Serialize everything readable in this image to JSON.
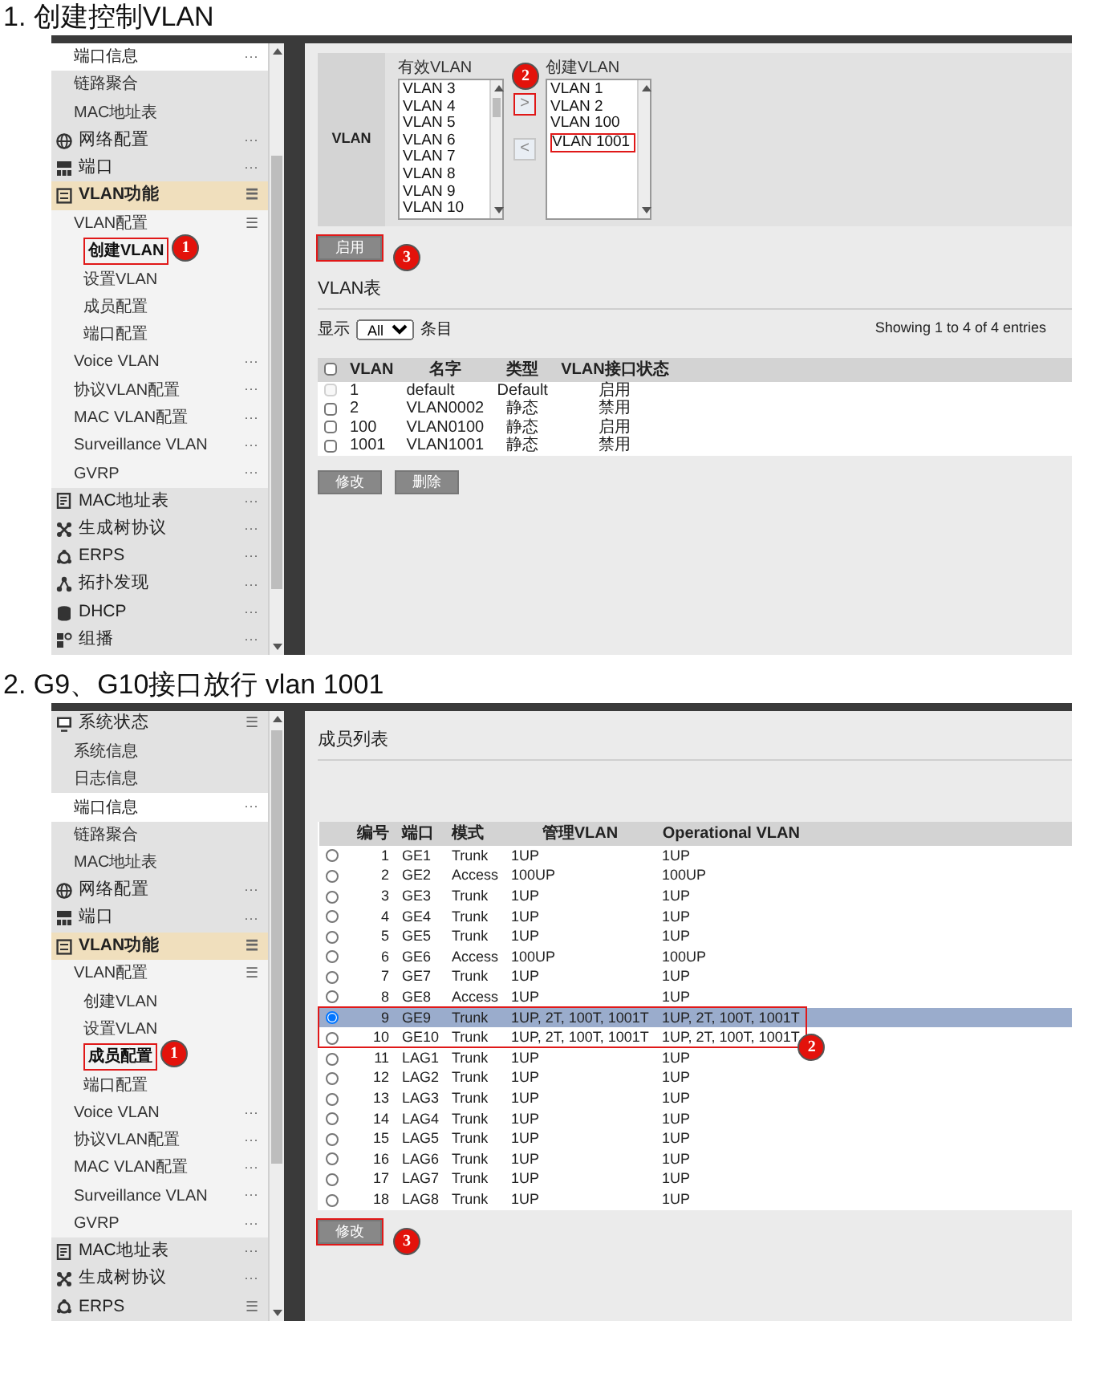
{
  "sections": [
    {
      "heading": "1. 创建控制VLAN",
      "sidebar": {
        "items": [
          {
            "kind": "link",
            "label": "端口信息",
            "menu": "···",
            "hovered": true,
            "selected": false
          },
          {
            "kind": "link",
            "label": "链路聚合",
            "hovered": false,
            "selected": false
          },
          {
            "kind": "link",
            "label": "MAC地址表",
            "hovered": false,
            "selected": false
          },
          {
            "kind": "group",
            "label": "网络配置",
            "menu": "···",
            "selected": false
          },
          {
            "kind": "group",
            "label": "端口",
            "menu": "···",
            "selected": false
          },
          {
            "kind": "group",
            "label": "VLAN功能",
            "menu": "☰",
            "selected": true,
            "children": [
              {
                "kind": "link",
                "label": "VLAN配置",
                "menu": "☰",
                "selected": false,
                "children": [
                  {
                    "kind": "link",
                    "label": "创建VLAN",
                    "selected": true,
                    "callout": "1"
                  },
                  {
                    "kind": "link",
                    "label": "设置VLAN",
                    "selected": false
                  },
                  {
                    "kind": "link",
                    "label": "成员配置",
                    "selected": false
                  },
                  {
                    "kind": "link",
                    "label": "端口配置",
                    "selected": false
                  }
                ]
              },
              {
                "kind": "link",
                "label": "Voice VLAN",
                "menu": "···",
                "selected": false
              },
              {
                "kind": "link",
                "label": "协议VLAN配置",
                "menu": "···",
                "selected": false
              },
              {
                "kind": "link",
                "label": "MAC VLAN配置",
                "menu": "···",
                "selected": false
              },
              {
                "kind": "link",
                "label": "Surveillance VLAN",
                "menu": "···",
                "selected": false
              },
              {
                "kind": "link",
                "label": "GVRP",
                "menu": "···",
                "selected": false
              }
            ]
          },
          {
            "kind": "group",
            "label": "MAC地址表",
            "menu": "···",
            "selected": false
          },
          {
            "kind": "group",
            "label": "生成树协议",
            "menu": "···",
            "selected": false
          },
          {
            "kind": "group",
            "label": "ERPS",
            "menu": "···",
            "selected": false
          },
          {
            "kind": "group",
            "label": "拓扑发现",
            "menu": "···",
            "selected": false
          },
          {
            "kind": "group",
            "label": "DHCP",
            "menu": "···",
            "selected": false
          },
          {
            "kind": "group",
            "label": "组播",
            "menu": "···",
            "selected": false
          }
        ]
      },
      "content": {
        "kind": "create_vlan",
        "form": {
          "label": "VLAN",
          "available": {
            "title": "有效VLAN",
            "options": [
              {
                "label": "VLAN 3",
                "selected": false
              },
              {
                "label": "VLAN 4",
                "selected": false
              },
              {
                "label": "VLAN 5",
                "selected": false
              },
              {
                "label": "VLAN 6",
                "selected": false
              },
              {
                "label": "VLAN 7",
                "selected": false
              },
              {
                "label": "VLAN 8",
                "selected": false
              },
              {
                "label": "VLAN 9",
                "selected": false
              },
              {
                "label": "VLAN 10",
                "selected": false
              }
            ]
          },
          "add_button": {
            "label": ">",
            "marked": true,
            "callout": "2"
          },
          "remove_button": {
            "label": "<",
            "marked": false
          },
          "created": {
            "title": "创建VLAN",
            "options": [
              {
                "label": "VLAN 1",
                "selected": false
              },
              {
                "label": "VLAN 2",
                "selected": false
              },
              {
                "label": "VLAN 100",
                "selected": false
              },
              {
                "label": "VLAN 1001",
                "selected": true
              }
            ]
          }
        },
        "apply_button": {
          "label": "启用",
          "marked": true,
          "callout": "3"
        },
        "table_title": "VLAN表",
        "length_menu": {
          "prefix": "显示",
          "value": "All",
          "suffix": "条目"
        },
        "info": "Showing 1 to 4 of 4 entries",
        "table": {
          "columns": [
            "VLAN",
            "名字",
            "类型",
            "VLAN接口状态"
          ],
          "header_checked": false,
          "rows": [
            {
              "cells": [
                "1",
                "default",
                "Default",
                "启用"
              ],
              "checked": false,
              "disabled": true
            },
            {
              "cells": [
                "2",
                "VLAN0002",
                "静态",
                "禁用"
              ],
              "checked": false,
              "disabled": false
            },
            {
              "cells": [
                "100",
                "VLAN0100",
                "静态",
                "启用"
              ],
              "checked": false,
              "disabled": false
            },
            {
              "cells": [
                "1001",
                "VLAN1001",
                "静态",
                "禁用"
              ],
              "checked": false,
              "disabled": false
            }
          ]
        },
        "buttons": [
          {
            "label": "修改",
            "marked": false
          },
          {
            "label": "删除",
            "marked": false
          }
        ]
      }
    },
    {
      "heading": "2. G9、G10接口放行 vlan 1001",
      "sidebar": {
        "items": [
          {
            "kind": "group",
            "label": "系统状态",
            "menu": "☰",
            "selected": false,
            "children": [
              {
                "kind": "link",
                "label": "系统信息",
                "hovered": false,
                "selected": false
              },
              {
                "kind": "link",
                "label": "日志信息",
                "hovered": false,
                "selected": false
              },
              {
                "kind": "link",
                "label": "端口信息",
                "menu": "···",
                "hovered": true,
                "selected": false
              },
              {
                "kind": "link",
                "label": "链路聚合",
                "hovered": false,
                "selected": false
              },
              {
                "kind": "link",
                "label": "MAC地址表",
                "hovered": false,
                "selected": false
              }
            ]
          },
          {
            "kind": "group",
            "label": "网络配置",
            "menu": "···",
            "selected": false
          },
          {
            "kind": "group",
            "label": "端口",
            "menu": "···",
            "selected": false
          },
          {
            "kind": "group",
            "label": "VLAN功能",
            "menu": "☰",
            "selected": true,
            "children": [
              {
                "kind": "link",
                "label": "VLAN配置",
                "menu": "☰",
                "selected": false,
                "children": [
                  {
                    "kind": "link",
                    "label": "创建VLAN",
                    "selected": false
                  },
                  {
                    "kind": "link",
                    "label": "设置VLAN",
                    "selected": false
                  },
                  {
                    "kind": "link",
                    "label": "成员配置",
                    "selected": true,
                    "callout": "1"
                  },
                  {
                    "kind": "link",
                    "label": "端口配置",
                    "selected": false
                  }
                ]
              },
              {
                "kind": "link",
                "label": "Voice VLAN",
                "menu": "···",
                "selected": false
              },
              {
                "kind": "link",
                "label": "协议VLAN配置",
                "menu": "···",
                "selected": false
              },
              {
                "kind": "link",
                "label": "MAC VLAN配置",
                "menu": "···",
                "selected": false
              },
              {
                "kind": "link",
                "label": "Surveillance VLAN",
                "menu": "···",
                "selected": false
              },
              {
                "kind": "link",
                "label": "GVRP",
                "menu": "···",
                "selected": false
              }
            ]
          },
          {
            "kind": "group",
            "label": "MAC地址表",
            "menu": "···",
            "selected": false
          },
          {
            "kind": "group",
            "label": "生成树协议",
            "menu": "···",
            "selected": false
          },
          {
            "kind": "group",
            "label": "ERPS",
            "menu": "☰",
            "selected": false
          }
        ]
      },
      "content": {
        "kind": "members",
        "title": "成员列表",
        "table": {
          "columns": [
            "编号",
            "端口",
            "模式",
            "管理VLAN",
            "Operational VLAN"
          ],
          "rows": [
            {
              "cells": [
                "1",
                "GE1",
                "Trunk",
                "1UP",
                "1UP"
              ],
              "selected": false,
              "marked": false
            },
            {
              "cells": [
                "2",
                "GE2",
                "Access",
                "100UP",
                "100UP"
              ],
              "selected": false,
              "marked": false
            },
            {
              "cells": [
                "3",
                "GE3",
                "Trunk",
                "1UP",
                "1UP"
              ],
              "selected": false,
              "marked": false
            },
            {
              "cells": [
                "4",
                "GE4",
                "Trunk",
                "1UP",
                "1UP"
              ],
              "selected": false,
              "marked": false
            },
            {
              "cells": [
                "5",
                "GE5",
                "Trunk",
                "1UP",
                "1UP"
              ],
              "selected": false,
              "marked": false
            },
            {
              "cells": [
                "6",
                "GE6",
                "Access",
                "100UP",
                "100UP"
              ],
              "selected": false,
              "marked": false
            },
            {
              "cells": [
                "7",
                "GE7",
                "Trunk",
                "1UP",
                "1UP"
              ],
              "selected": false,
              "marked": false
            },
            {
              "cells": [
                "8",
                "GE8",
                "Access",
                "1UP",
                "1UP"
              ],
              "selected": false,
              "marked": false
            },
            {
              "cells": [
                "9",
                "GE9",
                "Trunk",
                "1UP, 2T, 100T, 1001T",
                "1UP, 2T, 100T, 1001T"
              ],
              "selected": true,
              "marked": true
            },
            {
              "cells": [
                "10",
                "GE10",
                "Trunk",
                "1UP, 2T, 100T, 1001T",
                "1UP, 2T, 100T, 1001T"
              ],
              "selected": false,
              "marked": true,
              "callout": "2"
            },
            {
              "cells": [
                "11",
                "LAG1",
                "Trunk",
                "1UP",
                "1UP"
              ],
              "selected": false,
              "marked": false
            },
            {
              "cells": [
                "12",
                "LAG2",
                "Trunk",
                "1UP",
                "1UP"
              ],
              "selected": false,
              "marked": false
            },
            {
              "cells": [
                "13",
                "LAG3",
                "Trunk",
                "1UP",
                "1UP"
              ],
              "selected": false,
              "marked": false
            },
            {
              "cells": [
                "14",
                "LAG4",
                "Trunk",
                "1UP",
                "1UP"
              ],
              "selected": false,
              "marked": false
            },
            {
              "cells": [
                "15",
                "LAG5",
                "Trunk",
                "1UP",
                "1UP"
              ],
              "selected": false,
              "marked": false
            },
            {
              "cells": [
                "16",
                "LAG6",
                "Trunk",
                "1UP",
                "1UP"
              ],
              "selected": false,
              "marked": false
            },
            {
              "cells": [
                "17",
                "LAG7",
                "Trunk",
                "1UP",
                "1UP"
              ],
              "selected": false,
              "marked": false
            },
            {
              "cells": [
                "18",
                "LAG8",
                "Trunk",
                "1UP",
                "1UP"
              ],
              "selected": false,
              "marked": false
            }
          ]
        },
        "buttons": [
          {
            "label": "修改",
            "marked": true,
            "callout": "3"
          }
        ]
      }
    }
  ]
}
